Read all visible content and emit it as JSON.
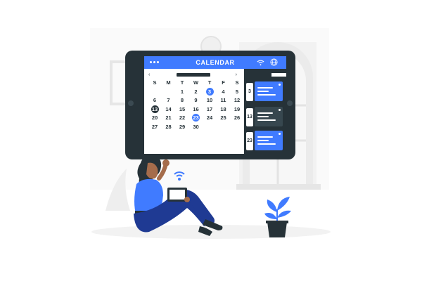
{
  "calendar": {
    "title": "CALENDAR",
    "weekdays": [
      "S",
      "M",
      "T",
      "W",
      "T",
      "F",
      "S"
    ],
    "weeks": [
      [
        "",
        "",
        "1",
        "2",
        "3",
        "4",
        "5"
      ],
      [
        "6",
        "7",
        "8",
        "9",
        "10",
        "11",
        "12"
      ],
      [
        "13",
        "14",
        "15",
        "16",
        "17",
        "18",
        "19"
      ],
      [
        "20",
        "21",
        "22",
        "23",
        "24",
        "25",
        "26"
      ],
      [
        "27",
        "28",
        "29",
        "30",
        "",
        "",
        ""
      ]
    ],
    "highlight_blue": [
      "3",
      "23"
    ],
    "highlight_dark": [
      "13"
    ],
    "events": [
      {
        "day": "3",
        "style": "blue"
      },
      {
        "day": "13",
        "style": "dark"
      },
      {
        "day": "23",
        "style": "blue"
      }
    ],
    "prev_arrow": "‹",
    "next_arrow": "›"
  },
  "colors": {
    "accent": "#407bff",
    "dark": "#263238",
    "background_gray": "#f5f5f5"
  },
  "icons": [
    "menu-dots-icon",
    "wifi-icon",
    "globe-icon",
    "plant-icon",
    "clock-icon",
    "phone-wifi-icon"
  ]
}
